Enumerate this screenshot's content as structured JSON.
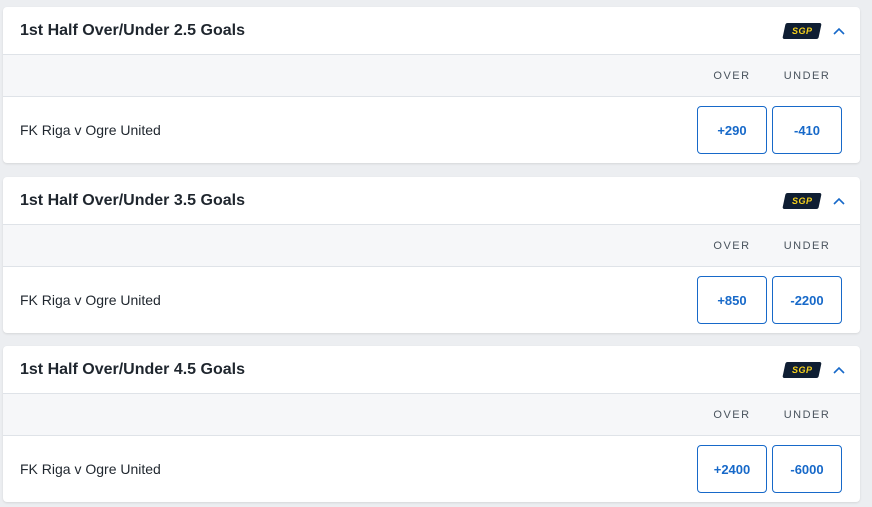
{
  "markets": [
    {
      "title": "1st Half Over/Under 2.5 Goals",
      "badge": "SGP",
      "columns": {
        "over": "OVER",
        "under": "UNDER"
      },
      "event": "FK Riga v Ogre United",
      "odds": {
        "over": "+290",
        "under": "-410"
      }
    },
    {
      "title": "1st Half Over/Under 3.5 Goals",
      "badge": "SGP",
      "columns": {
        "over": "OVER",
        "under": "UNDER"
      },
      "event": "FK Riga v Ogre United",
      "odds": {
        "over": "+850",
        "under": "-2200"
      }
    },
    {
      "title": "1st Half Over/Under 4.5 Goals",
      "badge": "SGP",
      "columns": {
        "over": "OVER",
        "under": "UNDER"
      },
      "event": "FK Riga v Ogre United",
      "odds": {
        "over": "+2400",
        "under": "-6000"
      }
    }
  ],
  "colors": {
    "accent": "#1769c9",
    "badge_bg": "#0f1e33",
    "badge_text": "#f7d21b",
    "page_bg": "#eceef1"
  },
  "icons": {
    "collapse": "chevron-up-icon",
    "badge": "sgp-badge-icon"
  }
}
